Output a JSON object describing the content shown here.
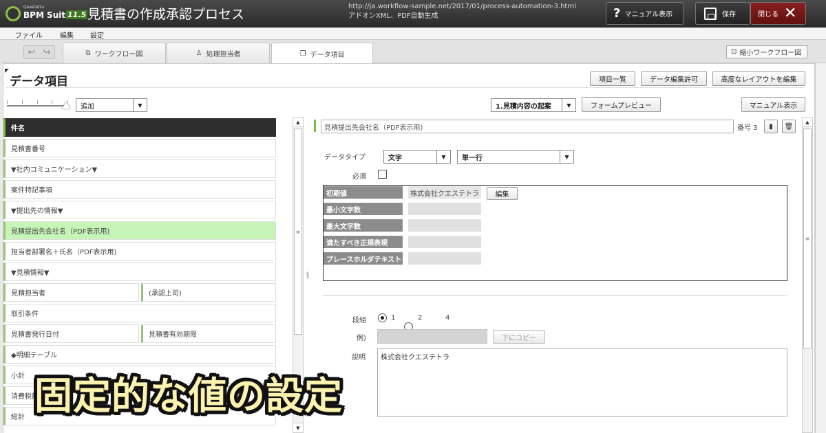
{
  "app": {
    "logo_sub": "Questetra",
    "logo_name": "BPM Suite",
    "logo_version": "11.5",
    "title": "見積書の作成承認プロセス",
    "url": "http://ja.workflow-sample.net/2017/01/process-automation-3.html",
    "url_note": "アドオンXML、PDF自動生成",
    "manual_label": "マニュアル表示",
    "save_label": "保存",
    "close_label": "閉じる"
  },
  "menu": [
    "ファイル",
    "編集",
    "設定"
  ],
  "tabs": [
    {
      "label": "ワークフロー図",
      "icon": "workflow-icon"
    },
    {
      "label": "処理担当者",
      "icon": "person-icon"
    },
    {
      "label": "データ項目",
      "icon": "data-items-icon",
      "active": true
    }
  ],
  "mini_workflow_label": "縮小ワークフロー図",
  "page": {
    "title": "データ項目",
    "btn_item_list": "項目一覧",
    "btn_data_edit_permission": "データ編集許可",
    "btn_advanced_layout": "高度なレイアウトを編集",
    "add_select_value": "追加",
    "step_select_value": "1.見積内容の起案",
    "btn_form_preview": "フォームプレビュー",
    "btn_manual": "マニュアル表示"
  },
  "list": {
    "header": "件名",
    "rows": [
      {
        "label": "見積書番号"
      },
      {
        "label": "▼社内コミュニケーション▼"
      },
      {
        "label": "案件特記事項"
      },
      {
        "label": "▼提出先の情報▼"
      },
      {
        "label": "見積提出先会社名（PDF表示用)",
        "selected": true
      },
      {
        "label": "担当者部署名＋氏名（PDF表示用)"
      },
      {
        "label": "▼見積情報▼"
      },
      {
        "label": "見積担当者",
        "right": "(承認上司)"
      },
      {
        "label": "取引条件"
      },
      {
        "label": "見積書発行日付",
        "right": "見積書有効期限"
      },
      {
        "label": "◆明細テーブル"
      },
      {
        "label": "小計"
      },
      {
        "label": "消費税額"
      },
      {
        "label": "総計"
      }
    ]
  },
  "detail": {
    "field_name": "見積提出先会社名（PDF表示用)",
    "number_label": "番号 3",
    "data_type_label": "データタイプ",
    "data_type_value": "文字",
    "line_type_value": "単一行",
    "required_label": "必須",
    "props": [
      {
        "label": "初期値",
        "value": "株式会社クエステトラ"
      },
      {
        "label": "最小文字数",
        "value": ""
      },
      {
        "label": "最大文字数",
        "value": ""
      },
      {
        "label": "満たすべき正規表現",
        "value": ""
      },
      {
        "label": "プレースホルダテキスト",
        "value": ""
      }
    ],
    "edit_button": "編集",
    "columns_label": "段組",
    "column_options": [
      "1",
      "2",
      "4"
    ],
    "column_selected": "1",
    "example_label": "例)",
    "copy_below_button": "下にコピー",
    "description_label": "説明",
    "description_value": "株式会社クエステトラ"
  },
  "caption": "固定的な値の設定"
}
